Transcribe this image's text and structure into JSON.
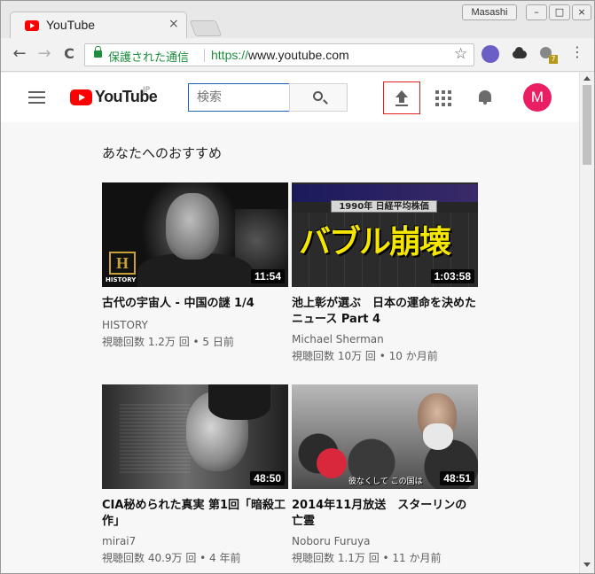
{
  "browser": {
    "tab_title": "YouTube",
    "tab_close": "×",
    "user_name": "Masashi",
    "win_minimize": "–",
    "win_maximize": "□",
    "win_close": "×",
    "nav_back": "←",
    "nav_forward": "→",
    "nav_reload": "C",
    "secure_label": "保護された通信",
    "url_scheme": "https://",
    "url_host": "www.youtube.com",
    "bookmark_star": "☆",
    "extension_badge": "7",
    "menu_icon": "⋮"
  },
  "header": {
    "logo_text": "YouTube",
    "logo_region": "JP",
    "search_placeholder": "検索",
    "avatar_letter": "M"
  },
  "main": {
    "section_title": "あなたへのおすすめ",
    "videos": [
      {
        "title": "古代の宇宙人 - 中国の謎 1/4",
        "channel": "HISTORY",
        "stats": "視聴回数 1.2万 回 • 5 日前",
        "duration": "11:54",
        "thumb_logo": "H",
        "thumb_text": "HISTORY"
      },
      {
        "title": "池上彰が選ぶ　日本の運命を決めたニュース Part 4",
        "channel": "Michael Sherman",
        "stats": "視聴回数 10万 回 • 10 か月前",
        "duration": "1:03:58",
        "thumb_head": "1990年 日経平均株価",
        "thumb_big": "バブル崩壊"
      },
      {
        "title": "CIA秘められた真実 第1回「暗殺工作」",
        "channel": "mirai7",
        "stats": "視聴回数 40.9万 回 • 4 年前",
        "duration": "48:50"
      },
      {
        "title": "2014年11月放送　スターリンの亡霊",
        "channel": "Noboru Furuya",
        "stats": "視聴回数 1.1万 回 • 11 か月前",
        "duration": "48:51",
        "thumb_sub": "彼なくして この国は"
      }
    ]
  }
}
